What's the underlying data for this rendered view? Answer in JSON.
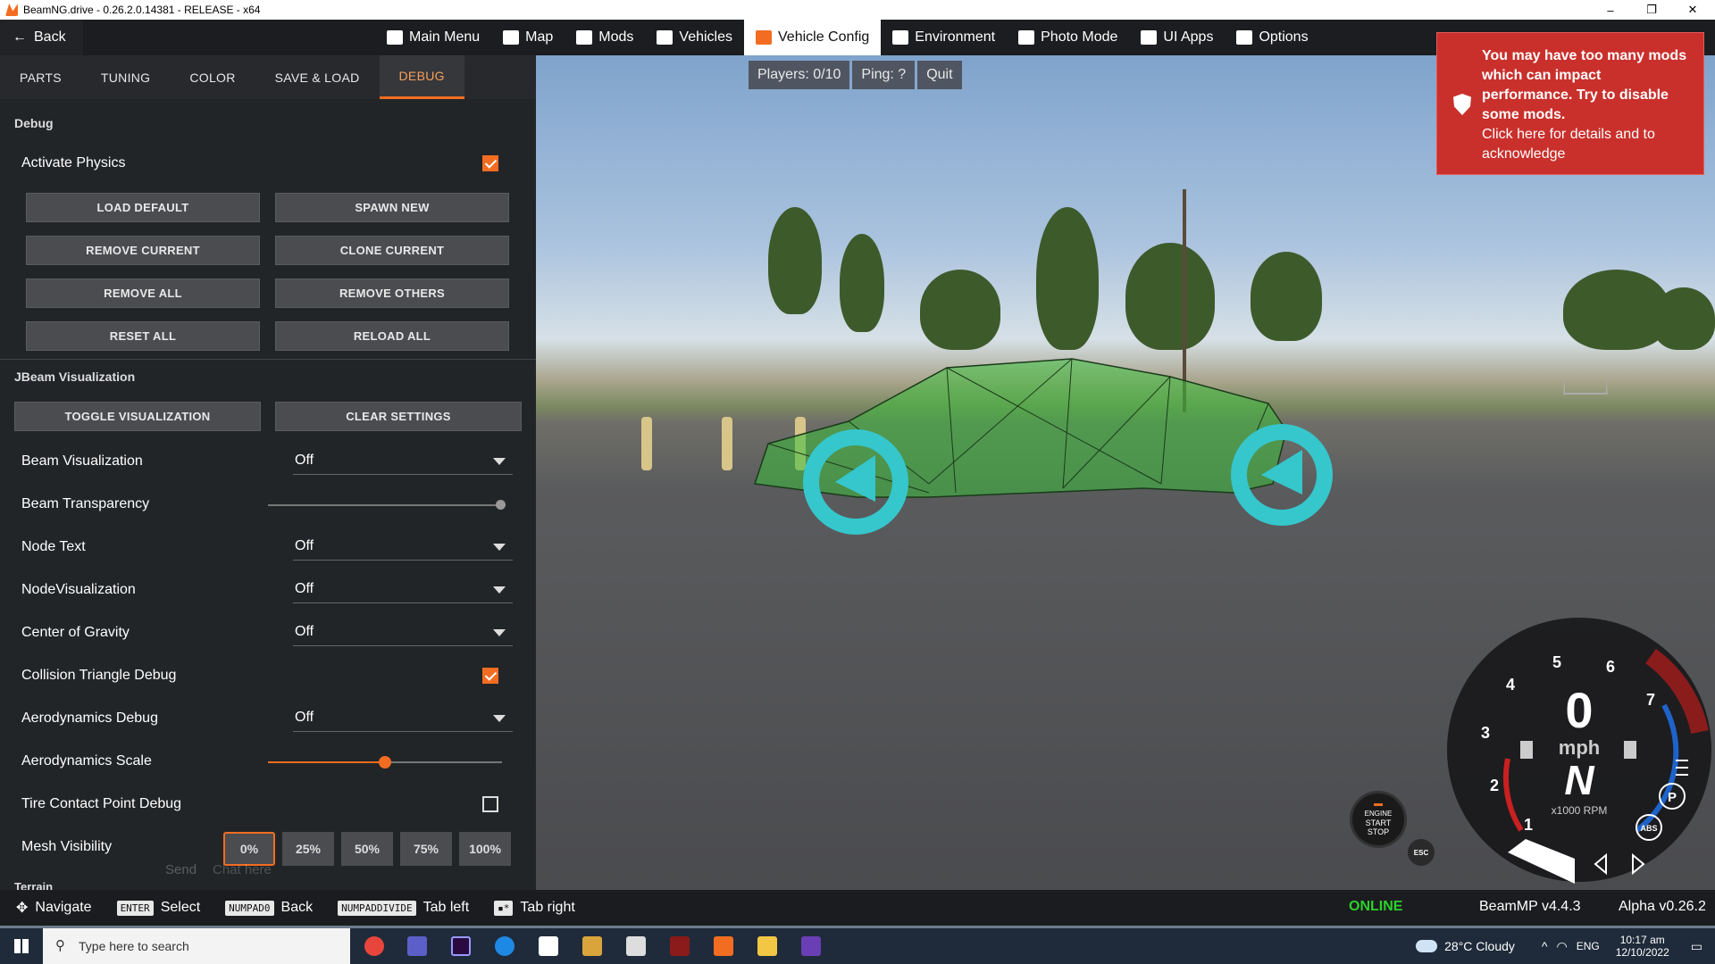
{
  "window": {
    "title": "BeamNG.drive - 0.26.2.0.14381 - RELEASE - x64"
  },
  "nav": {
    "back": "Back",
    "items": [
      {
        "label": "Main Menu",
        "icon": "main-menu-icon"
      },
      {
        "label": "Map",
        "icon": "map-icon"
      },
      {
        "label": "Mods",
        "icon": "puzzle-icon"
      },
      {
        "label": "Vehicles",
        "icon": "car-icon"
      },
      {
        "label": "Vehicle Config",
        "icon": "vehicle-config-icon",
        "active": true
      },
      {
        "label": "Environment",
        "icon": "weather-icon"
      },
      {
        "label": "Photo Mode",
        "icon": "camera-icon"
      },
      {
        "label": "UI Apps",
        "icon": "ui-apps-icon"
      },
      {
        "label": "Options",
        "icon": "sliders-icon"
      }
    ]
  },
  "multiplayer": {
    "players": "Players: 0/10",
    "ping": "Ping: ?",
    "quit": "Quit"
  },
  "tabs": [
    "PARTS",
    "TUNING",
    "COLOR",
    "SAVE & LOAD",
    "DEBUG"
  ],
  "debug": {
    "section": "Debug",
    "activate_physics": "Activate Physics",
    "buttons": [
      "LOAD DEFAULT",
      "SPAWN NEW",
      "REMOVE CURRENT",
      "CLONE CURRENT",
      "REMOVE ALL",
      "REMOVE OTHERS",
      "RESET ALL",
      "RELOAD ALL"
    ]
  },
  "jbeam": {
    "section": "JBeam Visualization",
    "toggle": "TOGGLE VISUALIZATION",
    "clear": "CLEAR SETTINGS",
    "rows": [
      {
        "label": "Beam Visualization",
        "value": "Off"
      },
      {
        "label": "Beam Transparency"
      },
      {
        "label": "Node Text",
        "value": "Off"
      },
      {
        "label": "NodeVisualization",
        "value": "Off"
      },
      {
        "label": "Center of Gravity",
        "value": "Off"
      },
      {
        "label": "Collision Triangle Debug"
      },
      {
        "label": "Aerodynamics Debug",
        "value": "Off"
      },
      {
        "label": "Aerodynamics Scale"
      },
      {
        "label": "Tire Contact Point Debug"
      },
      {
        "label": "Mesh Visibility"
      }
    ],
    "mesh_options": [
      "0%",
      "25%",
      "50%",
      "75%",
      "100%"
    ],
    "terrain": "Terrain",
    "chat_send": "Send",
    "chat_placeholder": "Chat here"
  },
  "alert": {
    "line1": "You may have too many mods which can impact performance. Try to disable some mods.",
    "line2": "Click here for details and to acknowledge"
  },
  "footer": {
    "navigate": "Navigate",
    "enter_key": "ENTER",
    "select": "Select",
    "numpad0": "NUMPAD0",
    "back": "Back",
    "numpaddiv": "NUMPADDIVIDE",
    "tab_left": "Tab left",
    "tab_right": "Tab right",
    "online": "ONLINE",
    "beammp": "BeamMP v4.4.3",
    "alpha": "Alpha v0.26.2"
  },
  "gauge": {
    "speed": "0",
    "unit": "mph",
    "gear": "N",
    "rpm_unit": "x1000 RPM",
    "ticks": [
      "1",
      "2",
      "3",
      "4",
      "5",
      "6",
      "7"
    ],
    "engine": [
      "ENGINE",
      "START",
      "STOP"
    ],
    "esc": "ESC",
    "abs": "ABS",
    "park": "P"
  },
  "taskbar": {
    "search": "Type here to search",
    "weather": "28°C  Cloudy",
    "lang": "ENG",
    "time": "10:17 am",
    "date": "12/10/2022"
  }
}
